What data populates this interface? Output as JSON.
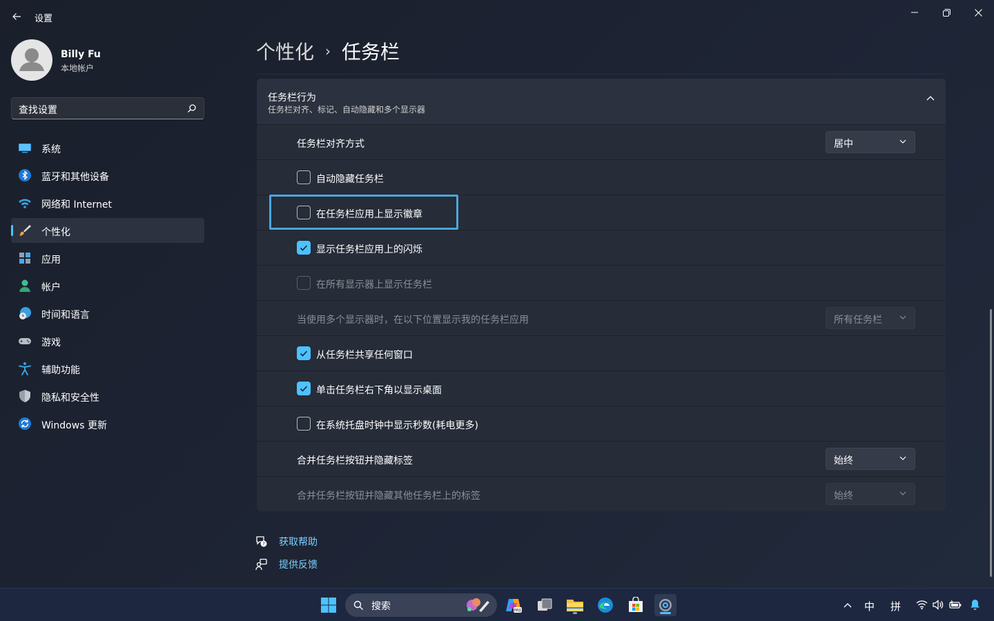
{
  "window": {
    "title": "设置"
  },
  "profile": {
    "name": "Billy Fu",
    "subtitle": "本地帐户"
  },
  "search": {
    "placeholder": "查找设置"
  },
  "sidebar": {
    "items": [
      {
        "label": "系统",
        "icon": "system-icon"
      },
      {
        "label": "蓝牙和其他设备",
        "icon": "bluetooth-icon"
      },
      {
        "label": "网络和 Internet",
        "icon": "wifi-icon"
      },
      {
        "label": "个性化",
        "icon": "brush-icon",
        "active": true
      },
      {
        "label": "应用",
        "icon": "apps-icon"
      },
      {
        "label": "帐户",
        "icon": "person-icon"
      },
      {
        "label": "时间和语言",
        "icon": "globe-clock-icon"
      },
      {
        "label": "游戏",
        "icon": "gamepad-icon"
      },
      {
        "label": "辅助功能",
        "icon": "accessibility-icon"
      },
      {
        "label": "隐私和安全性",
        "icon": "shield-icon"
      },
      {
        "label": "Windows 更新",
        "icon": "update-icon"
      }
    ]
  },
  "breadcrumb": {
    "parent": "个性化",
    "separator": "›",
    "current": "任务栏"
  },
  "section": {
    "title": "任务栏行为",
    "subtitle": "任务栏对齐、标记、自动隐藏和多个显示器",
    "rows": [
      {
        "type": "dropdown",
        "label": "任务栏对齐方式",
        "value": "居中",
        "enabled": true
      },
      {
        "type": "checkbox",
        "label": "自动隐藏任务栏",
        "checked": false,
        "enabled": true
      },
      {
        "type": "checkbox",
        "label": "在任务栏应用上显示徽章",
        "checked": false,
        "enabled": true,
        "focused": true
      },
      {
        "type": "checkbox",
        "label": "显示任务栏应用上的闪烁",
        "checked": true,
        "enabled": true
      },
      {
        "type": "checkbox",
        "label": "在所有显示器上显示任务栏",
        "checked": false,
        "enabled": false
      },
      {
        "type": "dropdown",
        "label": "当使用多个显示器时，在以下位置显示我的任务栏应用",
        "value": "所有任务栏",
        "enabled": false
      },
      {
        "type": "checkbox",
        "label": "从任务栏共享任何窗口",
        "checked": true,
        "enabled": true
      },
      {
        "type": "checkbox",
        "label": "单击任务栏右下角以显示桌面",
        "checked": true,
        "enabled": true
      },
      {
        "type": "checkbox",
        "label": "在系统托盘时钟中显示秒数(耗电更多)",
        "checked": false,
        "enabled": true
      },
      {
        "type": "dropdown",
        "label": "合并任务栏按钮并隐藏标签",
        "value": "始终",
        "enabled": true
      },
      {
        "type": "dropdown",
        "label": "合并任务栏按钮并隐藏其他任务栏上的标签",
        "value": "始终",
        "enabled": false
      }
    ]
  },
  "links": {
    "help": "获取帮助",
    "feedback": "提供反馈"
  },
  "taskbar": {
    "search_label": "搜索",
    "tray": {
      "ime_lang": "中",
      "ime_mode": "拼"
    }
  },
  "colors": {
    "accent": "#4cc2ff",
    "focus": "#4aa7dd"
  }
}
